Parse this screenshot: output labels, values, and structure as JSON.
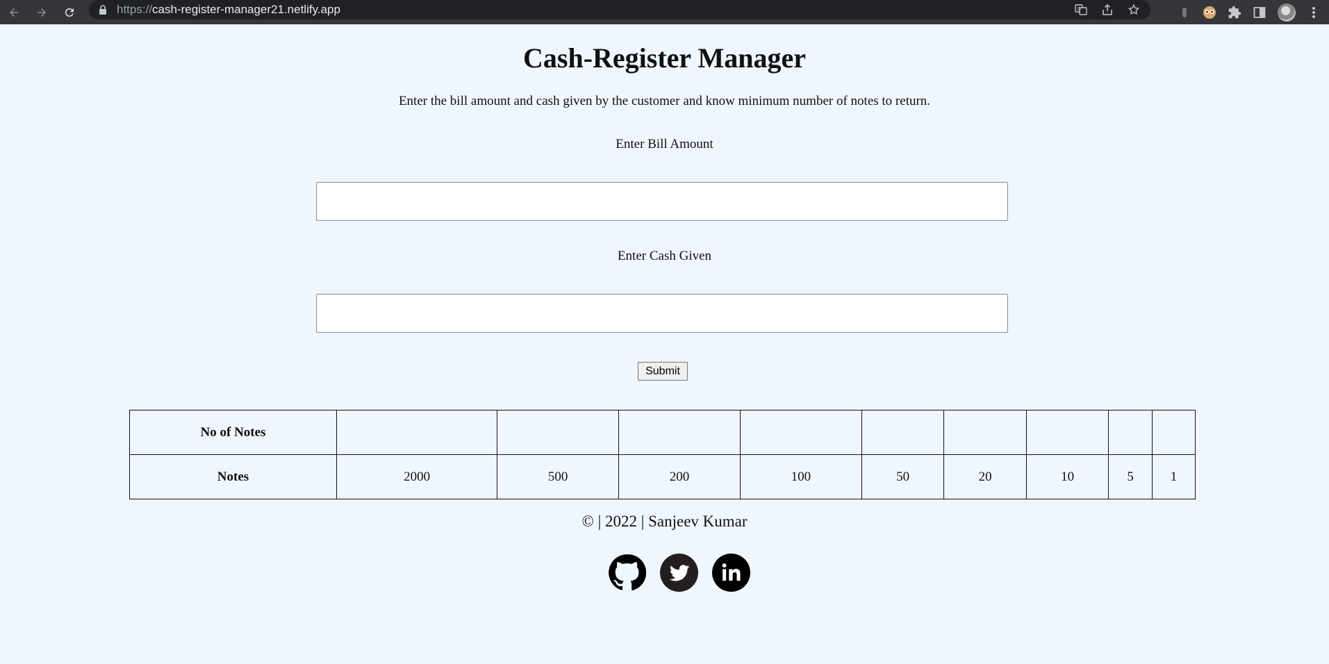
{
  "browser": {
    "url_scheme": "https://",
    "url_host": "cash-register-manager21.netlify.app"
  },
  "page": {
    "title": "Cash-Register Manager",
    "subtitle": "Enter the bill amount and cash given by the customer and know minimum number of notes to return.",
    "bill_label": "Enter Bill Amount",
    "bill_value": "",
    "cash_label": "Enter Cash Given",
    "cash_value": "",
    "submit_label": "Submit"
  },
  "table": {
    "row1_header": "No of Notes",
    "row2_header": "Notes",
    "counts": [
      "",
      "",
      "",
      "",
      "",
      "",
      "",
      "",
      ""
    ],
    "notes": [
      "2000",
      "500",
      "200",
      "100",
      "50",
      "20",
      "10",
      "5",
      "1"
    ]
  },
  "footer": {
    "text": "© | 2022 | Sanjeev Kumar"
  },
  "socials": [
    "github-icon",
    "twitter-icon",
    "linkedin-icon"
  ],
  "colors": {
    "background": "#eff6fd",
    "chrome": "#35363a"
  }
}
